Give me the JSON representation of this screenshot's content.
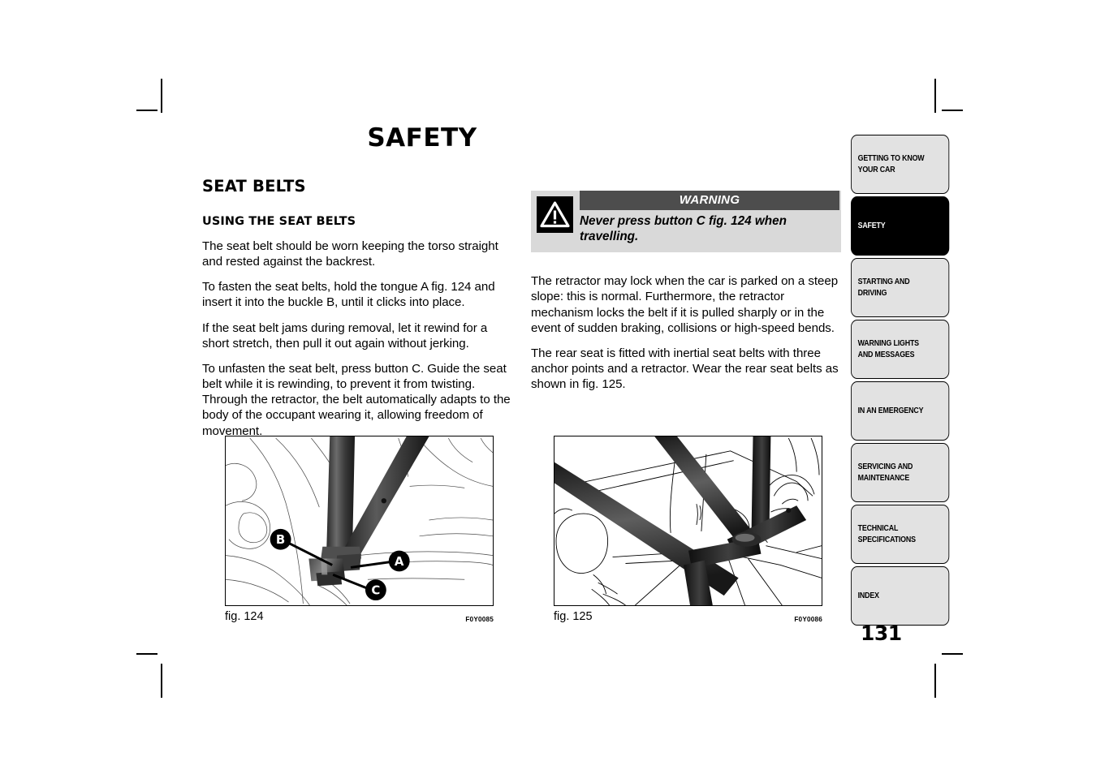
{
  "document": {
    "page_title": "SAFETY",
    "page_number": "131"
  },
  "left_column": {
    "section_title": "SEAT BELTS",
    "sub_title": "USING THE SEAT BELTS",
    "paragraphs": [
      "The seat belt should be worn keeping the torso straight and rested against the backrest.",
      "To fasten the seat belts, hold the tongue A fig. 124 and insert it into the buckle B, until it clicks into place.",
      "If the seat belt jams during removal, let it rewind for a short stretch, then pull it out again without jerking.",
      "To unfasten the seat belt, press button C. Guide the seat belt while it is rewinding, to prevent it from twisting. Through the retractor, the belt automatically adapts to the body of the occupant wearing it, allowing freedom of movement."
    ]
  },
  "warning": {
    "header": "WARNING",
    "text": "Never press button C fig. 124 when travelling.",
    "icon": "warning-triangle-icon",
    "bar_color": "#4d4d4d",
    "box_color": "#d9d9d9"
  },
  "right_column": {
    "paragraphs": [
      "The retractor may lock when the car is parked on a steep slope: this is normal. Furthermore, the retractor mechanism locks the belt if it is pulled sharply or in the event of sudden braking, collisions or high-speed bends.",
      "The rear seat is fitted with inertial seat belts with three anchor points and a retractor. Wear the rear seat belts as shown in fig. 125."
    ]
  },
  "figures": [
    {
      "caption": "fig. 124",
      "code": "F0Y0085",
      "callouts": [
        "B",
        "A",
        "C"
      ],
      "description": "Front seat belt buckle detail showing tongue A, buckle B and release button C"
    },
    {
      "caption": "fig. 125",
      "code": "F0Y0086",
      "callouts": [],
      "description": "Rear seat with three-point inertial seat belts fastened"
    }
  ],
  "sidebar": {
    "tabs": [
      {
        "label": "GETTING TO KNOW YOUR CAR",
        "lines": [
          "GETTING TO KNOW",
          "YOUR CAR"
        ],
        "active": false
      },
      {
        "label": "SAFETY",
        "lines": [
          "SAFETY"
        ],
        "active": true
      },
      {
        "label": "STARTING AND DRIVING",
        "lines": [
          "STARTING AND",
          "DRIVING"
        ],
        "active": false
      },
      {
        "label": "WARNING LIGHTS AND MESSAGES",
        "lines": [
          "WARNING LIGHTS",
          "AND MESSAGES"
        ],
        "active": false
      },
      {
        "label": "IN AN EMERGENCY",
        "lines": [
          "IN AN EMERGENCY"
        ],
        "active": false
      },
      {
        "label": "SERVICING AND MAINTENANCE",
        "lines": [
          "SERVICING AND",
          "MAINTENANCE"
        ],
        "active": false
      },
      {
        "label": "TECHNICAL SPECIFICATIONS",
        "lines": [
          "TECHNICAL",
          "SPECIFICATIONS"
        ],
        "active": false
      },
      {
        "label": "INDEX",
        "lines": [
          "INDEX"
        ],
        "active": false
      }
    ]
  }
}
